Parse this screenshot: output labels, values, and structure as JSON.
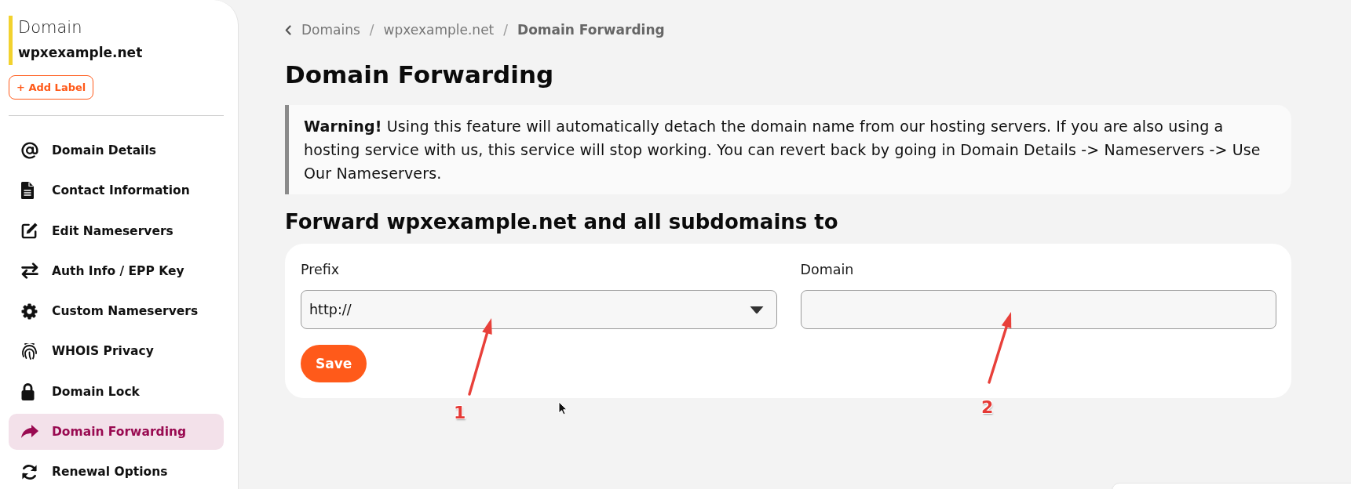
{
  "sidebar": {
    "heading": "Domain",
    "domain": "wpxexample.net",
    "add_label_button": "+ Add Label",
    "items": [
      {
        "label": "Domain Details",
        "selected": false
      },
      {
        "label": "Contact Information",
        "selected": false
      },
      {
        "label": "Edit Nameservers",
        "selected": false
      },
      {
        "label": "Auth Info / EPP Key",
        "selected": false
      },
      {
        "label": "Custom Nameservers",
        "selected": false
      },
      {
        "label": "WHOIS Privacy",
        "selected": false
      },
      {
        "label": "Domain Lock",
        "selected": false
      },
      {
        "label": "Domain Forwarding",
        "selected": true
      },
      {
        "label": "Renewal Options",
        "selected": false
      }
    ]
  },
  "breadcrumb": {
    "items": [
      {
        "label": "Domains",
        "current": false
      },
      {
        "label": "wpxexample.net",
        "current": false
      },
      {
        "label": "Domain Forwarding",
        "current": true
      }
    ],
    "separators": [
      "/",
      "/"
    ]
  },
  "page_title": "Domain Forwarding",
  "warning": {
    "text": "**Warning!** Using this feature will automatically detach the domain name from our hosting servers. If you are also using a hosting service with us, this service will stop working. You can revert back by going in Domain Details -> Nameservers -> Use Our Nameservers."
  },
  "form": {
    "heading": "Forward wpxexample.net and all subdomains to",
    "fields": [
      {
        "kind": "select",
        "label": "Prefix",
        "value": "http://"
      },
      {
        "kind": "text",
        "label": "Domain"
      }
    ],
    "save_button": "Save"
  },
  "annotations": [
    {
      "label": "1"
    },
    {
      "label": "2"
    }
  ]
}
